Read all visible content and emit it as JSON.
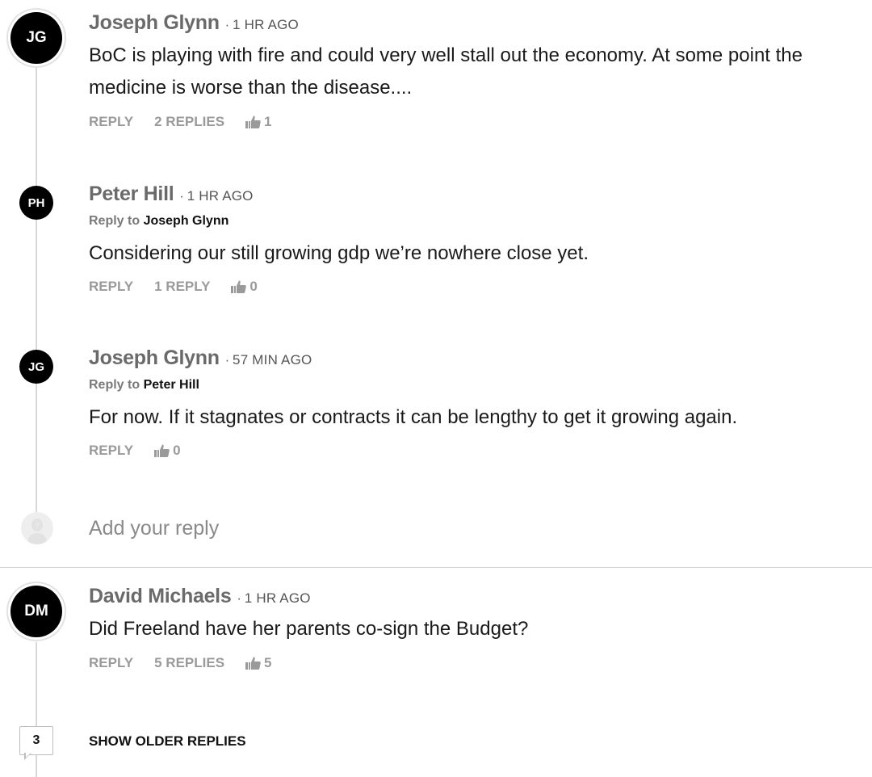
{
  "comments": [
    {
      "initials": "JG",
      "author": "Joseph Glynn",
      "time": "1 HR AGO",
      "body": "BoC is playing with fire and could very well stall out the economy. At some point the medicine is worse than the disease....",
      "reply_label": "REPLY",
      "replies_label": "2 REPLIES",
      "likes": "1"
    },
    {
      "initials": "PH",
      "author": "Peter Hill",
      "time": "1 HR AGO",
      "reply_to_prefix": "Reply to",
      "reply_to_name": "Joseph Glynn",
      "body": "Considering our still growing gdp we’re nowhere close yet.",
      "reply_label": "REPLY",
      "replies_label": "1 REPLY",
      "likes": "0"
    },
    {
      "initials": "JG",
      "author": "Joseph Glynn",
      "time": "57 MIN AGO",
      "reply_to_prefix": "Reply to",
      "reply_to_name": "Peter Hill",
      "body": "For now. If it stagnates or contracts it can be lengthy to get it growing again.",
      "reply_label": "REPLY",
      "likes": "0"
    },
    {
      "initials": "DM",
      "author": "David Michaels",
      "time": "1 HR AGO",
      "body": "Did Freeland have her parents co-sign the Budget?",
      "reply_label": "REPLY",
      "replies_label": "5 REPLIES",
      "likes": "5"
    }
  ],
  "add_reply": {
    "placeholder": "Add your reply"
  },
  "older_replies": {
    "count": "3",
    "label": "SHOW OLDER REPLIES"
  },
  "colors": {
    "avatar_bg": "#000000",
    "author": "#6a6a6a",
    "action": "#9a9a9a",
    "body": "#1a1a1a"
  },
  "icons": {
    "like": "thumbs-up-icon",
    "ghost_avatar": "user-placeholder-icon"
  }
}
